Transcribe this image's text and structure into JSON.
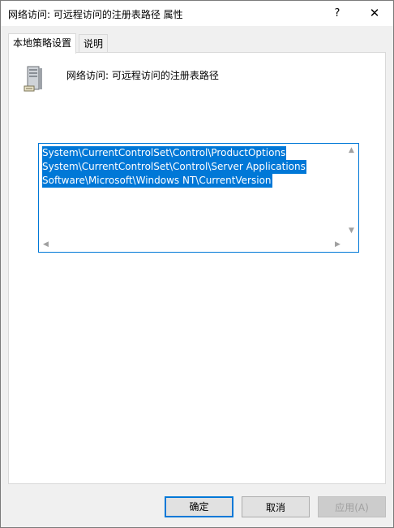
{
  "window": {
    "title": "网络访问: 可远程访问的注册表路径 属性",
    "help_label": "?",
    "close_label": "✕"
  },
  "tabs": [
    {
      "label": "本地策略设置",
      "active": true
    },
    {
      "label": "说明",
      "active": false
    }
  ],
  "policy": {
    "name": "网络访问: 可远程访问的注册表路径",
    "icon": "server-policy-icon"
  },
  "paths": [
    "System\\CurrentControlSet\\Control\\ProductOptions",
    "System\\CurrentControlSet\\Control\\Server Applications",
    "Software\\Microsoft\\Windows NT\\CurrentVersion"
  ],
  "buttons": {
    "ok": "确定",
    "cancel": "取消",
    "apply": "应用(A)"
  },
  "colors": {
    "selection": "#0078d7",
    "dialog_bg": "#f0f0f0"
  }
}
